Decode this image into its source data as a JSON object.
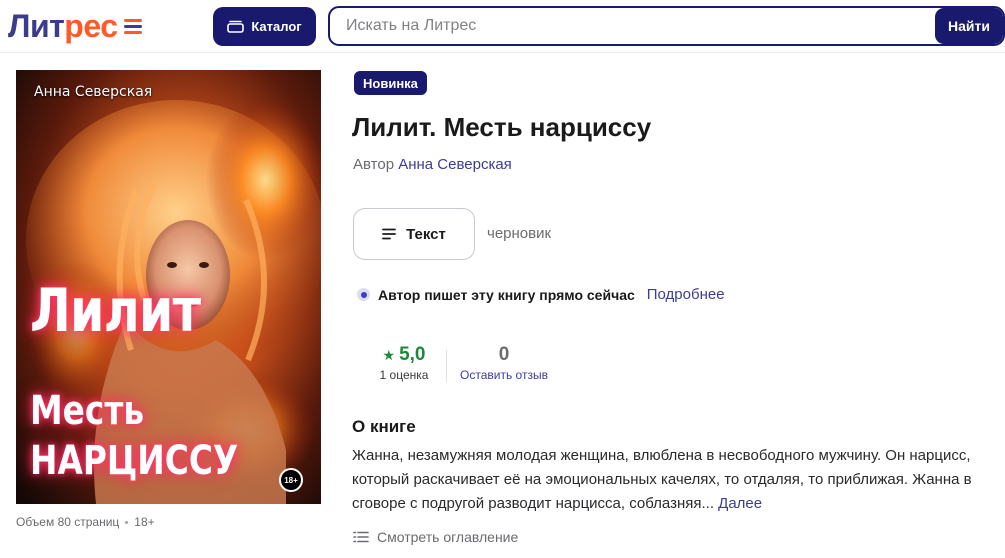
{
  "header": {
    "logo_part1": "Лит",
    "logo_part2": "рес",
    "catalog_label": "Каталог",
    "search_placeholder": "Искать на Литрес",
    "search_button": "Найти"
  },
  "cover": {
    "author": "Анна Северская",
    "title_line1": "Лилит",
    "title_line2": "Месть",
    "title_line3": "НАРЦИССУ",
    "age_badge": "18+"
  },
  "cover_meta": {
    "volume": "Объем 80 страниц",
    "age": "18+"
  },
  "book": {
    "badge": "Новинка",
    "title": "Лилит. Месть нарциссу",
    "author_prefix": "Автор",
    "author_name": "Анна Северская",
    "format_label": "Текст",
    "status": "черновик",
    "writing_text": "Автор пишет эту книгу прямо сейчас",
    "writing_link": "Подробнее"
  },
  "rating": {
    "value": "5,0",
    "count_label": "1 оценка",
    "reviews_value": "0",
    "reviews_link": "Оставить отзыв"
  },
  "about": {
    "heading": "О книге",
    "text": "Жанна, незамужняя молодая женщина, влюблена в несвободного мужчину. Он нарцисс, который раскачивает её на эмоциональных качелях, то отдаляя, то приближая. Жанна в сговоре с подругой разводит нарцисса, соблазняя...",
    "more_link": "Далее",
    "toc_link": "Смотреть оглавление"
  },
  "colors": {
    "brand_dark": "#19196e",
    "brand_orange": "#ff5a28",
    "link": "#3c3c9a",
    "rating_green": "#1a8a3a"
  },
  "icons": [
    "catalog-icon",
    "text-lines-icon",
    "star-icon",
    "list-icon",
    "logo-mark-icon"
  ]
}
